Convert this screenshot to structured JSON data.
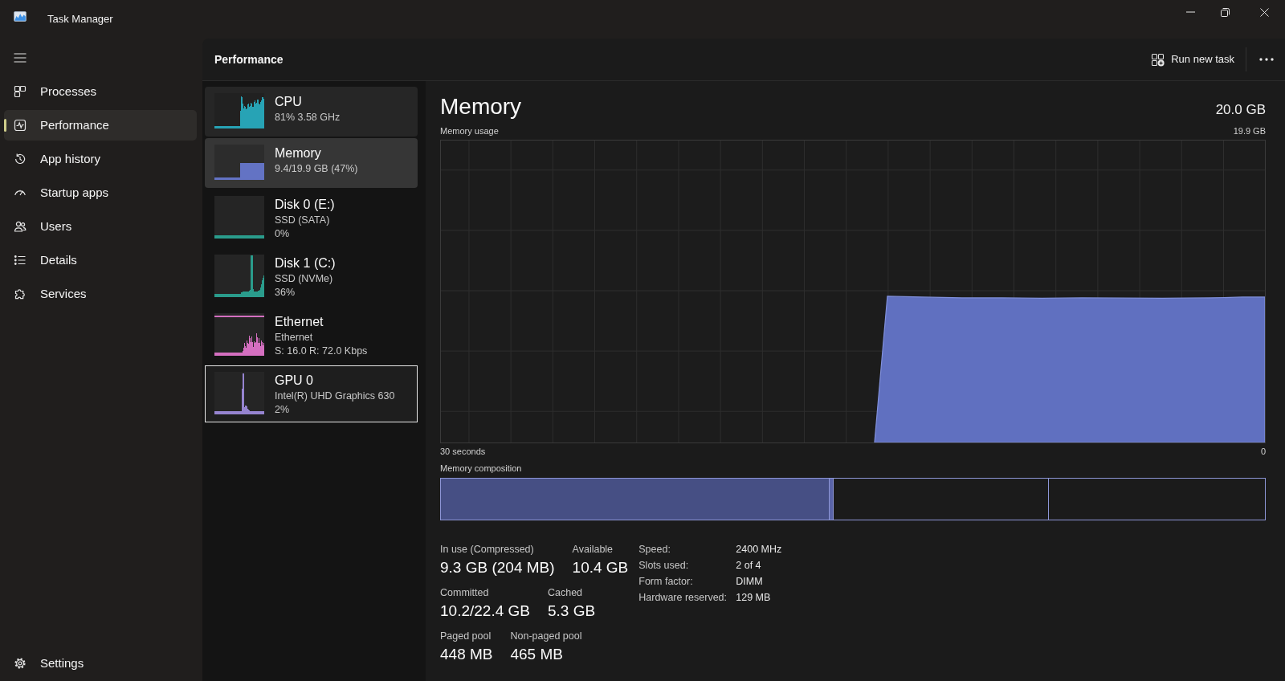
{
  "window": {
    "title": "Task Manager"
  },
  "sidebar": {
    "items": [
      {
        "label": "Processes",
        "selected": false
      },
      {
        "label": "Performance",
        "selected": true
      },
      {
        "label": "App history",
        "selected": false
      },
      {
        "label": "Startup apps",
        "selected": false
      },
      {
        "label": "Users",
        "selected": false
      },
      {
        "label": "Details",
        "selected": false
      },
      {
        "label": "Services",
        "selected": false
      }
    ],
    "footer": {
      "label": "Settings"
    }
  },
  "header": {
    "title": "Performance",
    "action": {
      "label": "Run new task"
    }
  },
  "devices": [
    {
      "name": "CPU",
      "details": [
        "81% 3.58 GHz"
      ],
      "color": "#27a3b5",
      "selected": false,
      "hovered": true,
      "focused": false
    },
    {
      "name": "Memory",
      "details": [
        "9.4/19.9 GB (47%)"
      ],
      "color": "#6373c4",
      "selected": true,
      "hovered": false,
      "focused": false
    },
    {
      "name": "Disk 0 (E:)",
      "details": [
        "SSD (SATA)",
        "0%"
      ],
      "color": "#2a9c8c",
      "selected": false,
      "hovered": false,
      "focused": false
    },
    {
      "name": "Disk 1 (C:)",
      "details": [
        "SSD (NVMe)",
        "36%"
      ],
      "color": "#2a9c8c",
      "selected": false,
      "hovered": false,
      "focused": false
    },
    {
      "name": "Ethernet",
      "details": [
        "Ethernet",
        "S: 16.0 R: 72.0 Kbps"
      ],
      "color": "#d46fc0",
      "selected": false,
      "hovered": false,
      "focused": false
    },
    {
      "name": "GPU 0",
      "details": [
        "Intel(R) UHD Graphics 630",
        "2%"
      ],
      "color": "#9684d0",
      "selected": false,
      "hovered": false,
      "focused": true
    }
  ],
  "detail": {
    "title": "Memory",
    "total": "20.0 GB",
    "graph": {
      "label": "Memory usage",
      "max": "19.9 GB",
      "time_span": "30 seconds",
      "time_end": "0"
    },
    "composition": {
      "label": "Memory composition",
      "segments": [
        {
          "kind": "inuse",
          "level": 0.471
        },
        {
          "kind": "modified",
          "level": 0.005
        },
        {
          "kind": "standby"
        },
        {
          "kind": "free",
          "level": 0.263
        }
      ]
    },
    "stats": [
      {
        "items": [
          {
            "label": "In use (Compressed)",
            "value": "9.3 GB (204 MB)"
          },
          {
            "label": "Available",
            "value": "10.4 GB"
          }
        ]
      },
      {
        "items": [
          {
            "label": "Committed",
            "value": "10.2/22.4 GB"
          },
          {
            "label": "Cached",
            "value": "5.3 GB"
          }
        ]
      },
      {
        "items": [
          {
            "label": "Paged pool",
            "value": "448 MB"
          },
          {
            "label": "Non-paged pool",
            "value": "465 MB"
          }
        ]
      }
    ],
    "specs": [
      {
        "label": "Speed:",
        "value": "2400 MHz"
      },
      {
        "label": "Slots used:",
        "value": "2 of 4"
      },
      {
        "label": "Form factor:",
        "value": "DIMM"
      },
      {
        "label": "Hardware reserved:",
        "value": "129 MB"
      }
    ]
  }
}
